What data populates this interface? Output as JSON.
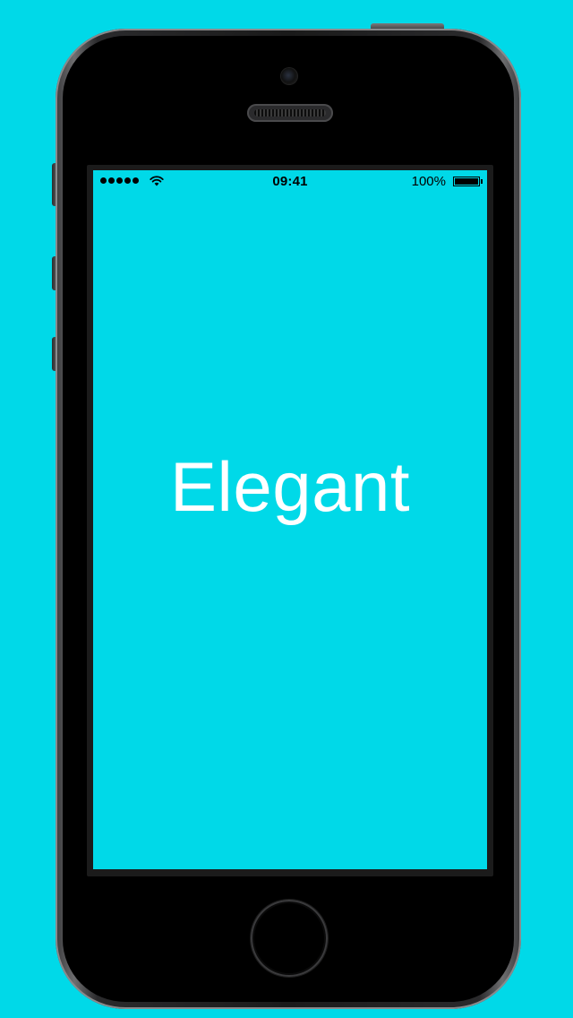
{
  "status_bar": {
    "signal_dots": 5,
    "wifi_icon": "wifi-icon",
    "time": "09:41",
    "battery_percent": "100%",
    "battery_level": 1.0
  },
  "screen": {
    "headline": "Elegant",
    "background_color": "#00d9e8",
    "text_color": "#ffffff"
  },
  "device": {
    "icons": [
      "front-camera-icon",
      "earpiece-speaker-icon",
      "home-button-icon"
    ]
  }
}
